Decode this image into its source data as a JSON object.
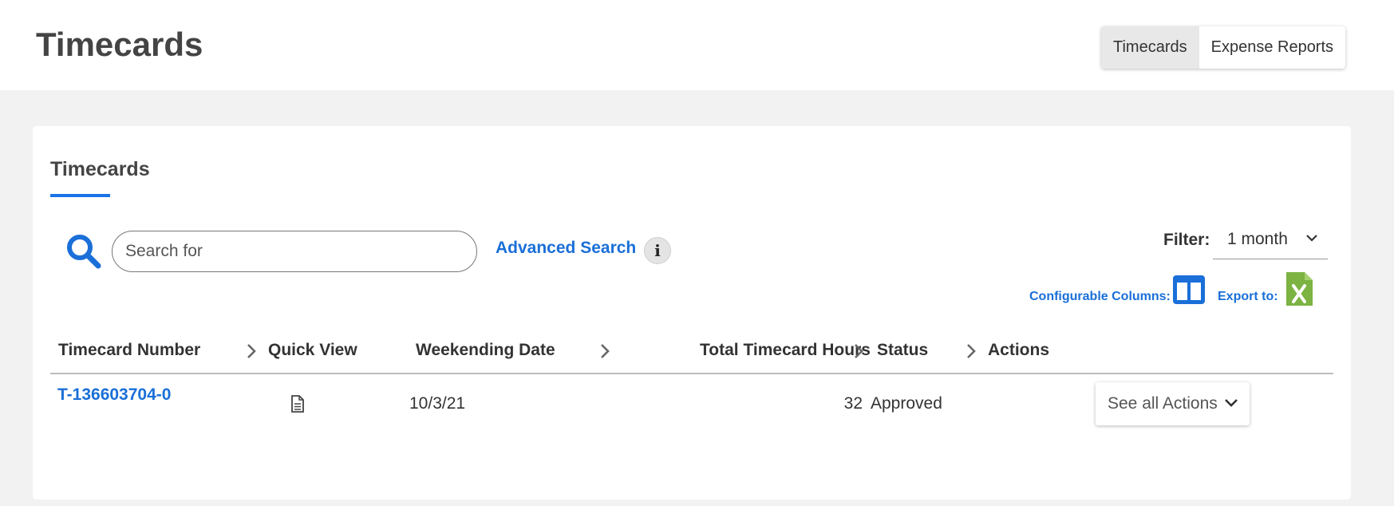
{
  "header": {
    "title": "Timecards",
    "toggle": [
      {
        "label": "Timecards",
        "active": true
      },
      {
        "label": "Expense Reports",
        "active": false
      }
    ]
  },
  "card": {
    "title": "Timecards",
    "search": {
      "placeholder": "Search for",
      "value": ""
    },
    "advanced_search_label": "Advanced Search",
    "info_icon": "info-icon",
    "filter": {
      "label": "Filter:",
      "selected": "1 month"
    },
    "configurable_columns_label": "Configurable Columns:",
    "export_label": "Export to:"
  },
  "table": {
    "columns": [
      "Timecard Number",
      "Quick View",
      "Weekending Date",
      "Total Timecard Hours",
      "Status",
      "Actions"
    ],
    "rows": [
      {
        "timecard_number": "T-136603704-0",
        "weekending_date": "10/3/21",
        "total_hours": "32",
        "status": "Approved",
        "actions_label": "See all Actions"
      }
    ]
  },
  "colors": {
    "accent": "#1a6fd8",
    "excel": "#7cb342",
    "background": "#f2f2f2"
  }
}
